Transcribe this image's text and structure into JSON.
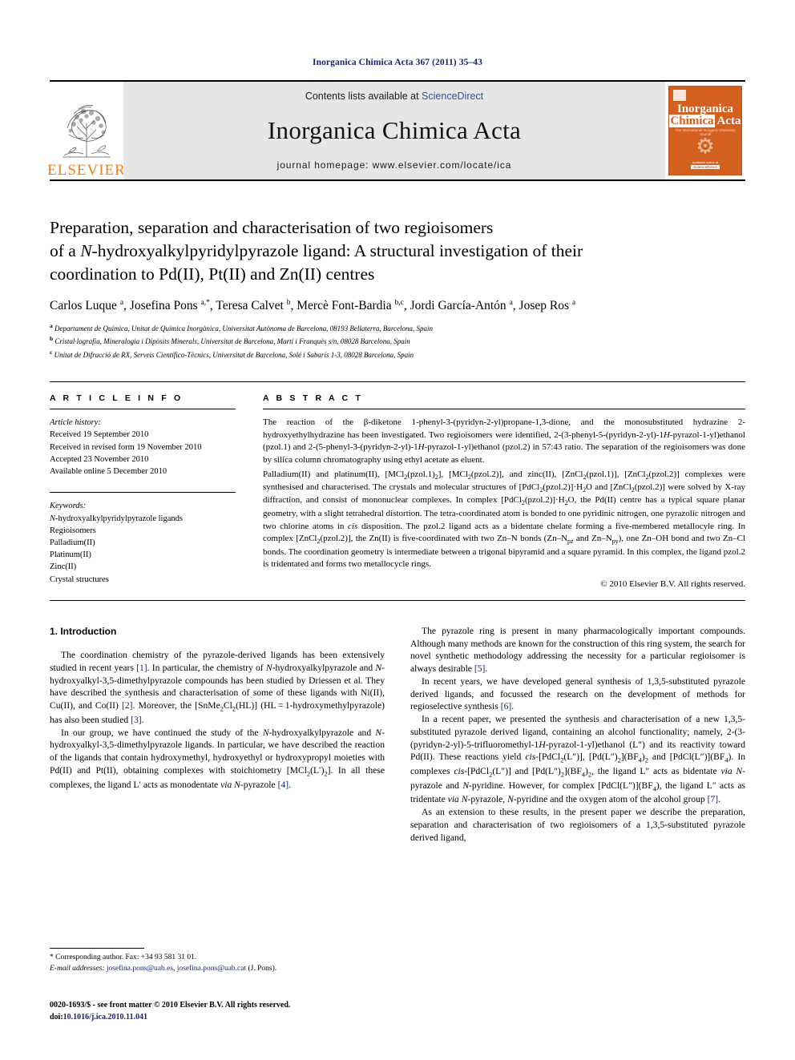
{
  "running_head": "Inorganica Chimica Acta 367 (2011) 35–43",
  "masthead": {
    "publisher_name": "ELSEVIER",
    "contents_prefix": "Contents lists available at ",
    "contents_link": "ScienceDirect",
    "journal_title": "Inorganica Chimica Acta",
    "homepage": "journal homepage: www.elsevier.com/locate/ica",
    "cover": {
      "line1": "Inorganica",
      "line2a": "Chimica",
      "line2b": "Acta",
      "subtitle": "The International Inorganic Chemistry Journal",
      "footer_label": "Available online at",
      "footer_brand": "ScienceDirect"
    },
    "accent_orange": "#d4601f",
    "link_blue": "#3b4fa0",
    "band_grey": "#e6e6e6"
  },
  "article": {
    "title_line1": "Preparation, separation and characterisation of two regioisomers",
    "title_line2": "of a N-hydroxyalkylpyridylpyrazole ligand: A structural investigation of their",
    "title_line3": "coordination to Pd(II), Pt(II) and Zn(II) centres",
    "authors": "Carlos Luque a, Josefina Pons a,*, Teresa Calvet b, Mercè Font-Bardia b,c, Jordi García-Antón a, Josep Ros a",
    "affiliations": [
      "a Departament de Química, Unitat de Química Inorgànica, Universitat Autònoma de Barcelona, 08193 Bellaterra, Barcelona, Spain",
      "b Cristal·lografia, Mineralogia i Dipòsits Minerals, Universitat de Barcelona, Martí i Franquès s/n, 08028 Barcelona, Spain",
      "c Unitat de Difracció de RX, Serveis Científico-Tècnics, Universitat de Barcelona, Solé i Sabarís 1-3, 08028 Barcelona, Spain"
    ]
  },
  "article_info": {
    "heading": "A R T I C L E  I N F O",
    "history_label": "Article history:",
    "history": [
      "Received 19 September 2010",
      "Received in revised form 19 November 2010",
      "Accepted 23 November 2010",
      "Available online 5 December 2010"
    ],
    "keywords_label": "Keywords:",
    "keywords": [
      "N-hydroxyalkylpyridylpyrazole ligands",
      "Regioisomers",
      "Palladium(II)",
      "Platinum(II)",
      "Zinc(II)",
      "Crystal structures"
    ]
  },
  "abstract": {
    "heading": "A B S T R A C T",
    "paragraph1": "The reaction of the β-diketone 1-phenyl-3-(pyridyn-2-yl)propane-1,3-dione, and the monosubstituted hydrazine 2-hydroxyethylhydrazine has been investigated. Two regioisomers were identified, 2-(3-phenyl-5-(pyridyn-2-yl)-1H-pyrazol-1-yl)ethanol (pzol.1) and 2-(5-phenyl-3-(pyridyn-2-yl)-1H-pyrazol-1-yl)ethanol (pzol.2) in 57:43 ratio. The separation of the regioisomers was done by silica column chromatography using ethyl acetate as eluent.",
    "paragraph2": "Palladium(II) and platinum(II), [MCl2(pzol.1)2], [MCl2(pzol.2)], and zinc(II), [ZnCl2(pzol.1)], [ZnCl2(pzol.2)] complexes were synthesised and characterised. The crystals and molecular structures of [PdCl2(pzol.2)]·H2O and [ZnCl2(pzol.2)] were solved by X-ray diffraction, and consist of mononuclear complexes. In complex [PdCl2(pzol.2)]·H2O, the Pd(II) centre has a typical square planar geometry, with a slight tetrahedral distortion. The tetra-coordinated atom is bonded to one pyridinic nitrogen, one pyrazolic nitrogen and two chlorine atoms in cis disposition. The pzol.2 ligand acts as a bidentate chelate forming a five-membered metallocyle ring. In complex [ZnCl2(pzol.2)], the Zn(II) is five-coordinated with two Zn–N bonds (Zn–Npz and Zn–Npy), one Zn–OH bond and two Zn–Cl bonds. The coordination geometry is intermediate between a trigonal bipyramid and a square pyramid. In this complex, the ligand pzol.2 is tridentated and forms two metallocycle rings.",
    "copyright": "© 2010 Elsevier B.V. All rights reserved."
  },
  "introduction": {
    "section_number_title": "1. Introduction",
    "left_paragraphs": [
      "The coordination chemistry of the pyrazole-derived ligands has been extensively studied in recent years [1]. In particular, the chemistry of N-hydroxyalkylpyrazole and N-hydroxyalkyl-3,5-dimethylpyrazole compounds has been studied by Driessen et al. They have described the synthesis and characterisation of some of these ligands with Ni(II), Cu(II), and Co(II) [2]. Moreover, the [SnMe2Cl2(HL)] (HL = 1-hydroxymethylpyrazole) has also been studied [3].",
      "In our group, we have continued the study of the N-hydroxyalkylpyrazole and N-hydroxyalkyl-3,5-dimethylpyrazole ligands. In particular, we have described the reaction of the ligands that contain hydroxymethyl, hydroxyethyl or hydroxypropyl moieties with Pd(II) and Pt(II), obtaining complexes with stoichiometry [MCl2(L′)2]. In all these complexes, the ligand L′ acts as monodentate via N-pyrazole [4]."
    ],
    "right_paragraphs": [
      "The pyrazole ring is present in many pharmacologically important compounds. Although many methods are known for the construction of this ring system, the search for novel synthetic methodology addressing the necessity for a particular regioisomer is always desirable [5].",
      "In recent years, we have developed general synthesis of 1,3,5-substituted pyrazole derived ligands, and focussed the research on the development of methods for regioselective synthesis [6].",
      "In a recent paper, we presented the synthesis and characterisation of a new 1,3,5-substituted pyrazole derived ligand, containing an alcohol functionality; namely, 2-(3-(pyridyn-2-yl)-5-trifluoromethyl-1H-pyrazol-1-yl)ethanol (L″) and its reactivity toward Pd(II). These reactions yield cis-[PdCl2(L″)], [Pd(L″)2](BF4)2 and [PdCl(L″)](BF4). In complexes cis-[PdCl2(L″)] and [Pd(L″)2](BF4)2, the ligand L″ acts as bidentate via N-pyrazole and N-pyridine. However, for complex [PdCl(L″)](BF4), the ligand L″ acts as tridentate via N-pyrazole, N-pyridine and the oxygen atom of the alcohol group [7].",
      "As an extension to these results, in the present paper we describe the preparation, separation and characterisation of two regioisomers of a 1,3,5-substituted pyrazole derived ligand,"
    ]
  },
  "footnote": {
    "corresponding": "* Corresponding author. Fax: +34 93 581 31 01.",
    "email_label": "E-mail addresses:",
    "email1": "josefina.pons@uab.es",
    "email_sep": ", ",
    "email2": "josefina.pons@uab.cat",
    "email_suffix": " (J. Pons)."
  },
  "imprint": {
    "issn_line": "0020-1693/$ - see front matter © 2010 Elsevier B.V. All rights reserved.",
    "doi_label": "doi:",
    "doi_value": "10.1016/j.ica.2010.11.041"
  }
}
